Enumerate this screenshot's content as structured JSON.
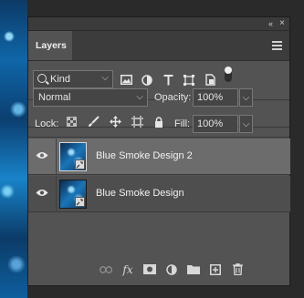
{
  "panel": {
    "title": "Layers",
    "collapse_glyph": "«",
    "close_glyph": "×"
  },
  "filter": {
    "kind_label": "Kind",
    "icons": [
      "image-filter-icon",
      "adjustment-filter-icon",
      "type-filter-icon",
      "shape-filter-icon",
      "smart-object-filter-icon",
      "filter-toggle"
    ]
  },
  "blend": {
    "mode": "Normal",
    "opacity_label": "Opacity:",
    "opacity_value": "100%"
  },
  "lock": {
    "label": "Lock:",
    "fill_label": "Fill:",
    "fill_value": "100%"
  },
  "layers": [
    {
      "name": "Blue Smoke Design 2",
      "selected": true,
      "visible": true
    },
    {
      "name": "Blue Smoke Design",
      "selected": false,
      "visible": true
    }
  ],
  "footer": {
    "icons": [
      "link-layers-icon",
      "fx-icon",
      "add-mask-icon",
      "new-adjustment-icon",
      "new-group-icon",
      "new-layer-icon",
      "delete-layer-icon"
    ],
    "fx_label": "fx"
  },
  "colors": {
    "panel_bg": "#535353",
    "selected_layer": "#6c6c6c",
    "tab_bar": "#3c3c3c",
    "background_image": "#0f66a8"
  }
}
